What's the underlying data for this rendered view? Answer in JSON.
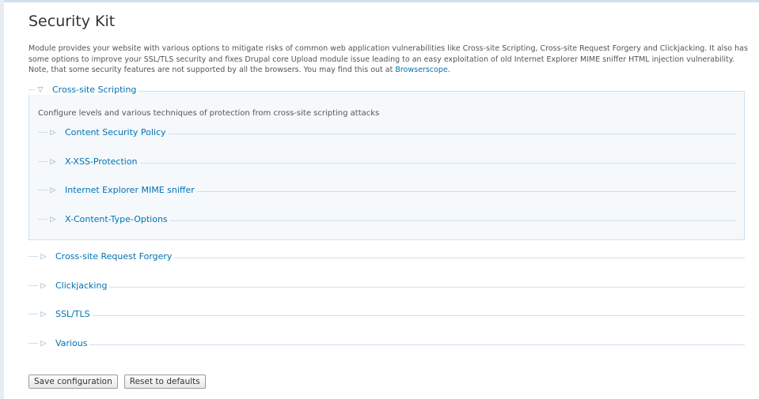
{
  "page": {
    "title": "Security Kit",
    "description_text": "Module provides your website with various options to mitigate risks of common web application vulnerabilities like Cross-site Scripting, Cross-site Request Forgery and Clickjacking. It also has some options to improve your SSL/TLS security and fixes Drupal core Upload module issue leading to an easy exploitation of old Internet Explorer MIME sniffer HTML injection vulnerability. Note, that some security features are not supported by all the browsers. You may find this out at ",
    "description_link": "Browserscope",
    "description_end": "."
  },
  "xss_fieldset": {
    "legend": "Cross-site Scripting",
    "description": "Configure levels and various techniques of protection from cross-site scripting attacks",
    "children": [
      {
        "legend": "Content Security Policy"
      },
      {
        "legend": "X-XSS-Protection"
      },
      {
        "legend": "Internet Explorer MIME sniffer"
      },
      {
        "legend": "X-Content-Type-Options"
      }
    ]
  },
  "fieldsets": [
    {
      "legend": "Cross-site Request Forgery"
    },
    {
      "legend": "Clickjacking"
    },
    {
      "legend": "SSL/TLS"
    },
    {
      "legend": "Various"
    }
  ],
  "actions": {
    "save_label": "Save configuration",
    "reset_label": "Reset to defaults"
  },
  "icons": {
    "expanded": "triangle-down-icon",
    "collapsed": "triangle-right-icon"
  },
  "colors": {
    "link": "#0071b3",
    "fieldset_bg": "#f5f9fc",
    "fieldset_border": "#cfdfec"
  }
}
